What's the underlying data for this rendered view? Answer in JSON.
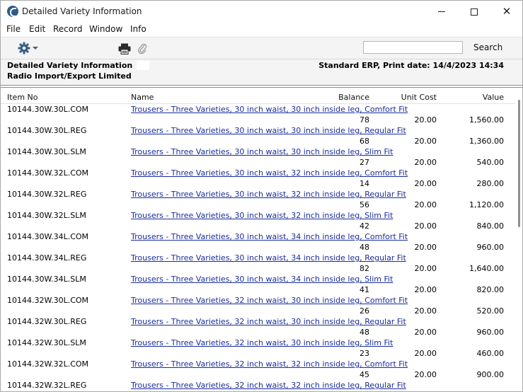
{
  "window": {
    "title": "Detailed Variety Information",
    "minimize": "minimize",
    "maximize": "maximize",
    "close": "✕"
  },
  "menu": [
    "File",
    "Edit",
    "Record",
    "Window",
    "Info"
  ],
  "toolbar": {
    "search_value": "",
    "search_label": "Search",
    "icons": [
      "gear-icon",
      "print-icon",
      "paperclip-icon"
    ]
  },
  "report": {
    "title": "Detailed Variety Information",
    "company": "Radio Import/Export Limited",
    "right": "Standard ERP, Print date: 14/4/2023 14:34"
  },
  "columns": {
    "item_no": "Item No",
    "name": "Name",
    "balance": "Balance",
    "unit_cost": "Unit Cost",
    "value": "Value"
  },
  "rows": [
    {
      "item": "10144.30W.30L.COM",
      "name": "Trousers - Three Varieties, 30 inch waist, 30 inch inside leg, Comfort Fit",
      "balance": "78",
      "cost": "20.00",
      "value": "1,560.00"
    },
    {
      "item": "10144.30W.30L.REG",
      "name": "Trousers - Three Varieties, 30 inch waist, 30 inch inside leg, Regular Fit",
      "balance": "68",
      "cost": "20.00",
      "value": "1,360.00"
    },
    {
      "item": "10144.30W.30L.SLM",
      "name": "Trousers - Three Varieties, 30 inch waist, 30 inch inside leg, Slim Fit",
      "balance": "27",
      "cost": "20.00",
      "value": "540.00"
    },
    {
      "item": "10144.30W.32L.COM",
      "name": "Trousers - Three Varieties, 30 inch waist, 32 inch inside leg, Comfort Fit",
      "balance": "14",
      "cost": "20.00",
      "value": "280.00"
    },
    {
      "item": "10144.30W.32L.REG",
      "name": "Trousers - Three Varieties, 30 inch waist, 32 inch inside leg, Regular Fit",
      "balance": "56",
      "cost": "20.00",
      "value": "1,120.00"
    },
    {
      "item": "10144.30W.32L.SLM",
      "name": "Trousers - Three Varieties, 30 inch waist, 32 inch inside leg, Slim Fit",
      "balance": "42",
      "cost": "20.00",
      "value": "840.00"
    },
    {
      "item": "10144.30W.34L.COM",
      "name": "Trousers - Three Varieties, 30 inch waist, 34 inch inside leg, Comfort Fit",
      "balance": "48",
      "cost": "20.00",
      "value": "960.00"
    },
    {
      "item": "10144.30W.34L.REG",
      "name": "Trousers - Three Varieties, 30 inch waist, 34 inch inside leg, Regular Fit",
      "balance": "82",
      "cost": "20.00",
      "value": "1,640.00"
    },
    {
      "item": "10144.30W.34L.SLM",
      "name": "Trousers - Three Varieties, 30 inch waist, 34 inch inside leg, Slim Fit",
      "balance": "41",
      "cost": "20.00",
      "value": "820.00"
    },
    {
      "item": "10144.32W.30L.COM",
      "name": "Trousers - Three Varieties, 32 inch waist, 30 inch inside leg, Comfort Fit",
      "balance": "26",
      "cost": "20.00",
      "value": "520.00"
    },
    {
      "item": "10144.32W.30L.REG",
      "name": "Trousers - Three Varieties, 32 inch waist, 30 inch inside leg, Regular Fit",
      "balance": "48",
      "cost": "20.00",
      "value": "960.00"
    },
    {
      "item": "10144.32W.30L.SLM",
      "name": "Trousers - Three Varieties, 32 inch waist, 30 inch inside leg, Slim Fit",
      "balance": "23",
      "cost": "20.00",
      "value": "460.00"
    },
    {
      "item": "10144.32W.32L.COM",
      "name": "Trousers - Three Varieties, 32 inch waist, 32 inch inside leg, Comfort Fit",
      "balance": "45",
      "cost": "20.00",
      "value": "900.00"
    },
    {
      "item": "10144.32W.32L.REG",
      "name": "Trousers - Three Varieties, 32 inch waist, 32 inch inside leg, Regular Fit",
      "balance": "",
      "cost": "",
      "value": ""
    }
  ],
  "colors": {
    "link": "#1a2d9a",
    "toolbar_bg": "#f4f4f4",
    "icon_blue": "#3a5f84"
  }
}
